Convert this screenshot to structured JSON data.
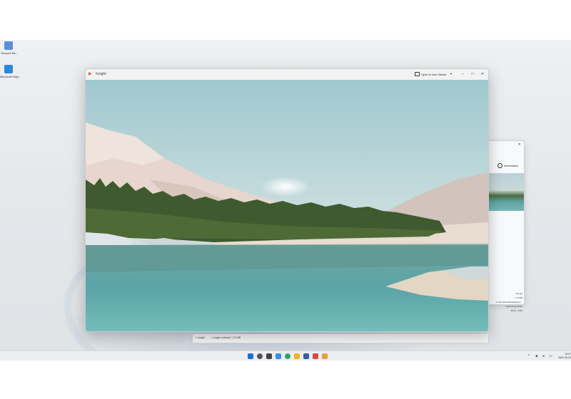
{
  "desktop": {
    "icons": [
      {
        "label": "Recycle Bin",
        "icon": "recycle-bin-icon",
        "color": "#5a8fd0"
      },
      {
        "label": "Microsoft Edge",
        "icon": "monitor-icon",
        "color": "#2b88d8"
      }
    ]
  },
  "viewer": {
    "app_name": "Insight",
    "app_icon": "insight-logo-icon",
    "open_button_label": "Open in new Viewer",
    "pin_icon": "pin-icon",
    "minimize_glyph": "–",
    "maximize_glyph": "□",
    "close_glyph": "✕"
  },
  "info_window": {
    "button_label": "Information",
    "close_glyph": "✕",
    "meta_lines": [
      "Info.jpg",
      "1.70 MB",
      "C:\\Users\\Public\\Wallpaper...",
      "2020-09-01 08:22",
      "3840 x 2400"
    ]
  },
  "statusbar": {
    "left": "1 Insight",
    "right": "1 Insight selected  1.70 MB"
  },
  "taskbar": {
    "apps": [
      {
        "name": "start-icon",
        "color": "#1e6fd9"
      },
      {
        "name": "search-icon",
        "color": "#555555"
      },
      {
        "name": "task-view-icon",
        "color": "#444444"
      },
      {
        "name": "widgets-icon",
        "color": "#3a8ee6"
      },
      {
        "name": "edge-icon",
        "color": "#2fa46a"
      },
      {
        "name": "file-explorer-icon",
        "color": "#f0b429"
      },
      {
        "name": "store-icon",
        "color": "#3b5da8"
      },
      {
        "name": "mail-icon",
        "color": "#d34b3c"
      },
      {
        "name": "photos-icon",
        "color": "#e4a23a"
      }
    ],
    "tray": {
      "chevron": "^",
      "wifi": "◈",
      "volume": "◂",
      "battery": "▭"
    },
    "clock_time": "10:07",
    "clock_date": "2021-06-24"
  },
  "colors": {
    "accent": "#1e6fd9",
    "titlebar": "#f3f3f3",
    "desktop": "#e4e7ea"
  }
}
